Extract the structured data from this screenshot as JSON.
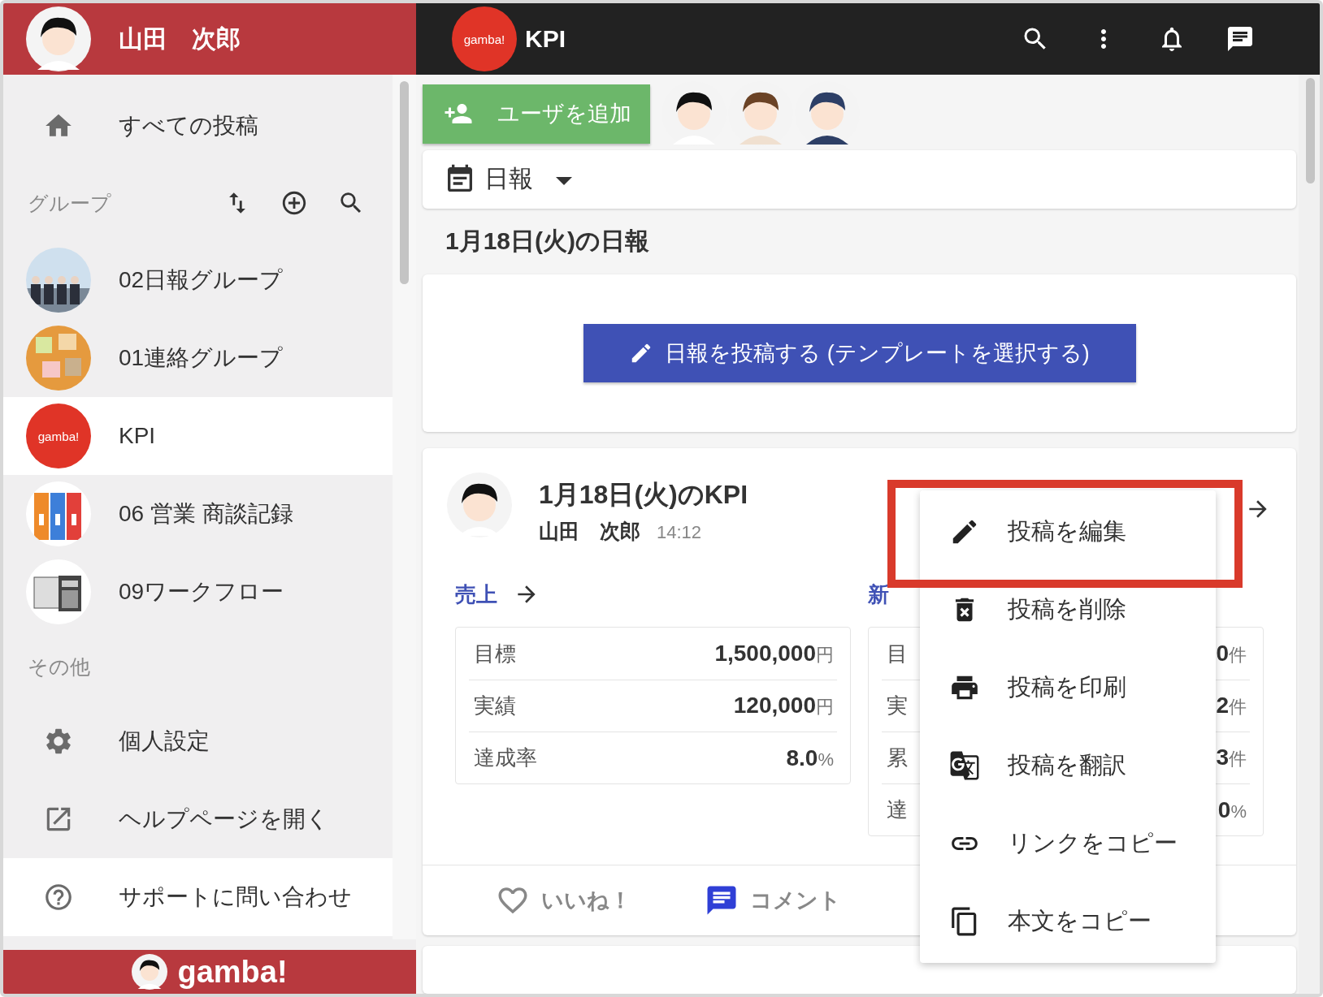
{
  "sidebar": {
    "user": {
      "name": "山田　次郎"
    },
    "items": [
      {
        "kind": "home",
        "label": "すべての投稿",
        "selected": false
      }
    ],
    "groups_header": {
      "label": "グループ"
    },
    "groups": [
      {
        "label": "02日報グループ",
        "selected": false
      },
      {
        "label": "01連絡グループ",
        "selected": false
      },
      {
        "label": "KPI",
        "selected": true,
        "logo": "gamba!"
      },
      {
        "label": "06 営業 商談記録",
        "selected": false
      },
      {
        "label": "09ワークフロー",
        "selected": false
      }
    ],
    "other_header": {
      "label": "その他"
    },
    "other_items": [
      {
        "kind": "settings",
        "label": "個人設定",
        "selected": false
      },
      {
        "kind": "external",
        "label": "ヘルプページを開く",
        "selected": false
      },
      {
        "kind": "help",
        "label": "サポートに問い合わせ",
        "selected": true
      }
    ],
    "footer": {
      "brand": "gamba!"
    }
  },
  "topbar": {
    "logo": "gamba!",
    "title": "KPI"
  },
  "add_user_button": {
    "label": "ユーザを追加"
  },
  "category_select": {
    "value": "日報"
  },
  "report_heading": "1月18日(火)の日報",
  "post_button": {
    "label": "日報を投稿する (テンプレートを選択する)"
  },
  "post": {
    "title": "1月18日(火)のKPI",
    "author": "山田　次郎",
    "time": "14:12",
    "sections": [
      {
        "title": "売上",
        "arrow": true,
        "rows": [
          {
            "label": "目標",
            "value": "1,500,000",
            "unit": "円"
          },
          {
            "label": "実績",
            "value": "120,000",
            "unit": "円"
          },
          {
            "label": "達成率",
            "value": "8.0",
            "unit": "%"
          }
        ]
      },
      {
        "title": "新",
        "rows": [
          {
            "label": "目",
            "value": "0",
            "unit": "件"
          },
          {
            "label": "実",
            "value": "2",
            "unit": "件"
          },
          {
            "label": "累",
            "value": "3",
            "unit": "件"
          },
          {
            "label": "達",
            "value": "0",
            "unit": "%"
          }
        ]
      }
    ],
    "actions": [
      {
        "kind": "like",
        "label": "いいね！"
      },
      {
        "kind": "comment",
        "label": "コメント"
      }
    ]
  },
  "context_menu": {
    "items": [
      {
        "kind": "edit",
        "label": "投稿を編集",
        "highlighted": true
      },
      {
        "kind": "delete",
        "label": "投稿を削除"
      },
      {
        "kind": "print",
        "label": "投稿を印刷"
      },
      {
        "kind": "translate",
        "label": "投稿を翻訳"
      },
      {
        "kind": "link",
        "label": "リンクをコピー"
      },
      {
        "kind": "copy",
        "label": "本文をコピー"
      }
    ]
  }
}
